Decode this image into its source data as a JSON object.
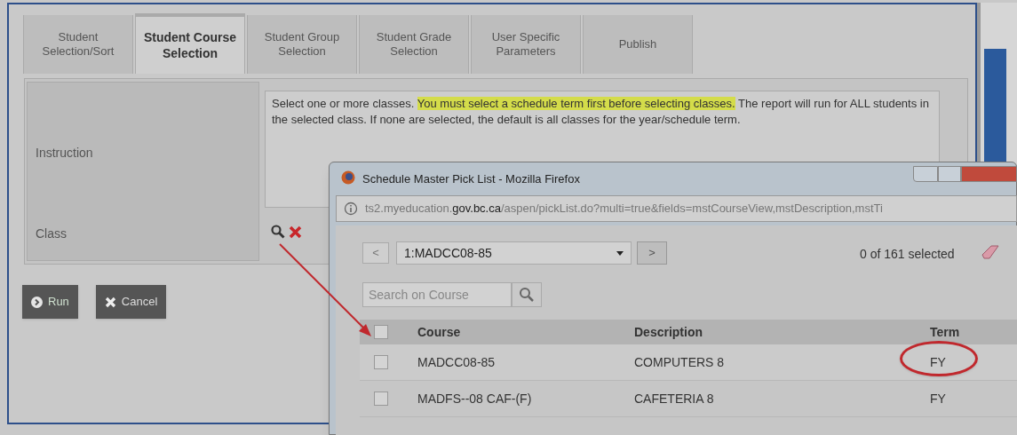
{
  "tabs": [
    {
      "label": "Student Selection/Sort",
      "selected": false
    },
    {
      "label": "Student Course Selection",
      "selected": true
    },
    {
      "label": "Student Group Selection",
      "selected": false
    },
    {
      "label": "Student Grade Selection",
      "selected": false
    },
    {
      "label": "User Specific Parameters",
      "selected": false
    },
    {
      "label": "Publish",
      "selected": false
    }
  ],
  "form": {
    "instruction_label": "Instruction",
    "instruction_parts": [
      {
        "text": "Select one or more classes. ",
        "highlighted": false
      },
      {
        "text": "You must select a schedule term first before selecting classes.",
        "highlighted": true
      },
      {
        "text": " The report will run for ALL students in the selected class. If none are selected, the default is all classes for the year/schedule term.",
        "highlighted": false
      }
    ],
    "class_label": "Class"
  },
  "buttons": [
    {
      "label": "Run",
      "kind": "run"
    },
    {
      "label": "Cancel",
      "kind": "cancel"
    }
  ],
  "popup": {
    "title": "Schedule Master Pick List - Mozilla Firefox",
    "url_parts": [
      {
        "text": "ts2.myeducation.",
        "domain": false
      },
      {
        "text": "gov.bc.ca",
        "domain": true
      },
      {
        "text": "/aspen/pickList.do?multi=true&fields=mstCourseView,mstDescription,mstTi",
        "domain": false
      }
    ],
    "prev": "<",
    "next": ">",
    "dropdown_value": "1:MADCC08-85",
    "selected_count": "0 of 161 selected",
    "search_placeholder": "Search on Course",
    "columns": [
      "Course",
      "Description",
      "Term"
    ],
    "header_checked": false,
    "rows": [
      {
        "cells": [
          "MADCC08-85",
          "COMPUTERS 8",
          "FY"
        ],
        "checked": false,
        "circled": true
      },
      {
        "cells": [
          "MADFS--08 CAF-(F)",
          "CAFETERIA 8",
          "FY"
        ],
        "checked": false,
        "circled": false
      }
    ]
  }
}
